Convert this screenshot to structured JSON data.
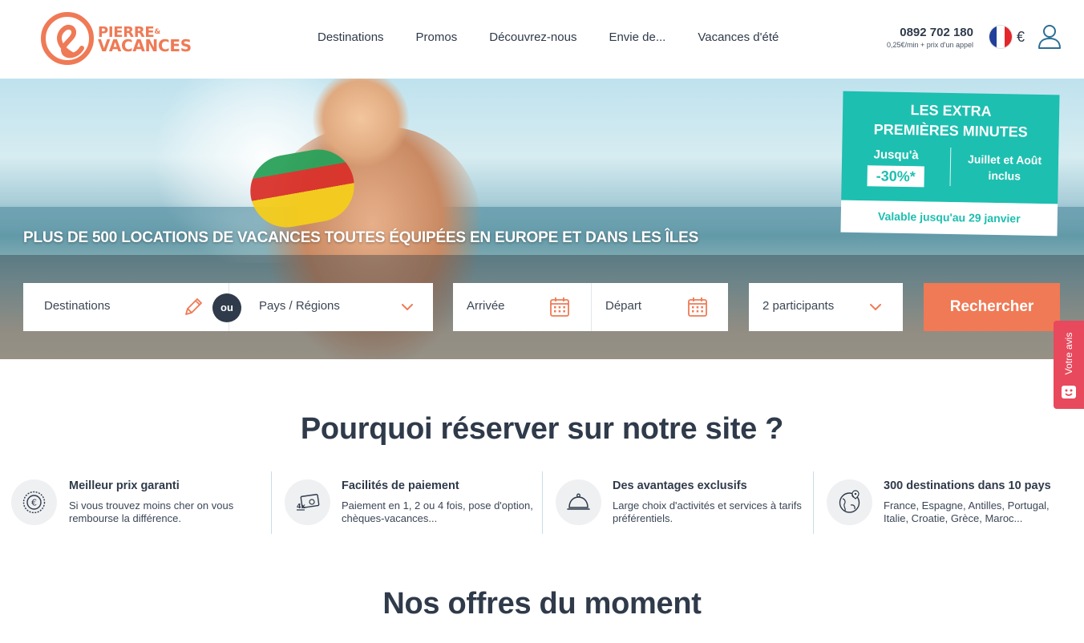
{
  "brand": {
    "name_line1": "PIERRE",
    "name_amp": "&",
    "name_line2": "VACANCES",
    "color": "#ef7a55"
  },
  "nav": {
    "items": [
      {
        "label": "Destinations"
      },
      {
        "label": "Promos"
      },
      {
        "label": "Découvrez-nous"
      },
      {
        "label": "Envie de..."
      },
      {
        "label": "Vacances d'été"
      }
    ]
  },
  "contact": {
    "phone": "0892 702 180",
    "phone_note": "0,25€/min + prix d'un appel"
  },
  "locale": {
    "flag": "france-flag-icon",
    "currency": "€"
  },
  "account": {
    "icon": "user-icon"
  },
  "hero": {
    "tagline": "PLUS DE 500 LOCATIONS DE VACANCES TOUTES ÉQUIPÉES EN EUROPE ET DANS LES ÎLES"
  },
  "promo": {
    "title_line1": "LES EXTRA",
    "title_line2": "PREMIÈRES MINUTES",
    "upto": "Jusqu'à",
    "discount": "-30%*",
    "months_line1": "Juillet et Août",
    "months_line2": "inclus",
    "validity": "Valable jusqu'au 29 janvier",
    "color": "#1dbfb0"
  },
  "search": {
    "destination_label": "Destinations",
    "destination_icon": "pencil-icon",
    "or_label": "ou",
    "region_label": "Pays / Régions",
    "region_icon": "chevron-down-icon",
    "arrival_label": "Arrivée",
    "departure_label": "Départ",
    "calendar_icon": "calendar-icon",
    "participants_label": "2 participants",
    "button_label": "Rechercher",
    "button_color": "#ef7a55"
  },
  "feedback": {
    "label": "Votre avis",
    "icon": "smiley-icon",
    "color": "#e8495c"
  },
  "why": {
    "title": "Pourquoi réserver sur notre site ?",
    "features": [
      {
        "icon": "euro-badge-icon",
        "title": "Meilleur prix garanti",
        "text": "Si vous trouvez moins cher on vous rembourse la différence."
      },
      {
        "icon": "payment-card-icon",
        "title": "Facilités de paiement",
        "text": "Paiement en 1, 2 ou 4 fois, pose d'option, chèques-vacances..."
      },
      {
        "icon": "cloche-icon",
        "title": "Des avantages exclusifs",
        "text": "Large choix d'activités et services à tarifs préférentiels."
      },
      {
        "icon": "globe-pin-icon",
        "title": "300 destinations dans 10 pays",
        "text": "France, Espagne, Antilles, Portugal, Italie, Croatie, Grèce, Maroc..."
      }
    ]
  },
  "offers": {
    "title": "Nos offres du moment"
  }
}
